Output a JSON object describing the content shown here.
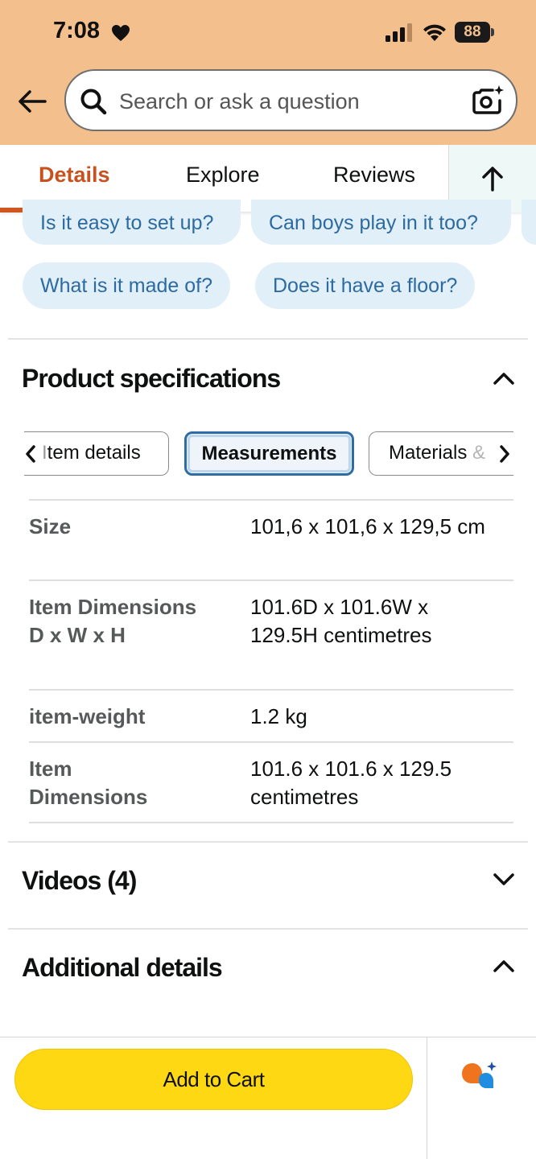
{
  "status_bar": {
    "time": "7:08",
    "battery": "88"
  },
  "search": {
    "placeholder": "Search or ask a question"
  },
  "tabs": [
    {
      "label": "Details",
      "active": true
    },
    {
      "label": "Explore",
      "active": false
    },
    {
      "label": "Reviews",
      "active": false
    }
  ],
  "questions": [
    "Is it easy to set up?",
    "Can boys play in it too?",
    "What is it made of?",
    "Does it have a floor?"
  ],
  "product_specifications": {
    "title": "Product specifications",
    "tabs": {
      "item_details_prefix": "I",
      "item_details_rest": "tem details",
      "measurements": "Measurements",
      "materials_main": "Materials",
      "materials_fade": " &"
    },
    "rows": [
      {
        "label": "Size",
        "value": "101,6 x 101,6 x 129,5 cm"
      },
      {
        "label": "Item Dimensions D x W x H",
        "value": "101.6D x 101.6W x 129.5H centimetres"
      },
      {
        "label": "item-weight",
        "value": "1.2 kg"
      },
      {
        "label": "Item Dimensions",
        "value": "101.6 x 101.6 x 129.5 centimetres"
      }
    ]
  },
  "videos": {
    "title": "Videos (4)"
  },
  "additional_details": {
    "title": "Additional details"
  },
  "bottom": {
    "add_to_cart": "Add to Cart"
  },
  "colors": {
    "header_bg": "#f3c08d",
    "active_tab": "#c7511f",
    "chip_bg": "#e1eff8",
    "chip_text": "#2c6aa0",
    "cart_button": "#ffd814",
    "selected_spec_border": "#2e6da4"
  },
  "icons": [
    "heart-icon",
    "signal-icon",
    "wifi-icon",
    "battery-icon",
    "back-arrow-icon",
    "search-icon",
    "camera-sparkle-icon",
    "up-arrow-icon",
    "chevron-up-icon",
    "chevron-down-icon",
    "chevron-left-icon",
    "chevron-right-icon",
    "rufus-assistant-icon"
  ]
}
